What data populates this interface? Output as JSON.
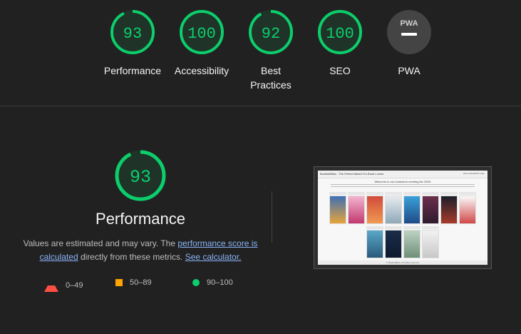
{
  "categories": [
    {
      "label": "Performance",
      "score": "93",
      "fraction": 0.93,
      "color": "#0cce6b"
    },
    {
      "label": "Accessibility",
      "score": "100",
      "fraction": 1.0,
      "color": "#0cce6b"
    },
    {
      "label": "Best\nPractices",
      "score": "92",
      "fraction": 0.92,
      "color": "#0cce6b"
    },
    {
      "label": "SEO",
      "score": "100",
      "fraction": 1.0,
      "color": "#0cce6b"
    },
    {
      "label": "PWA",
      "score": "",
      "badge": "PWA"
    }
  ],
  "performance": {
    "title": "Performance",
    "score": "93",
    "fraction": 0.93,
    "desc_prefix": "Values are estimated and may vary. The ",
    "desc_link1": "performance score is calculated",
    "desc_middle": " directly from these metrics. ",
    "desc_link2": "See calculator."
  },
  "legend": {
    "fail": "0–49",
    "average": "50–89",
    "pass": "90–100"
  },
  "screenshot": {
    "site_title": "BookishBliss - The Perfect Match For Book Lovers",
    "nav": "Home    Bookshelf    Login",
    "heading": "Welcome to our bookstore meeting list 2023!",
    "footer": "© BookishBliss. All rights reserved."
  },
  "colors": {
    "pass": "#0cce6b",
    "average": "#ffa400",
    "fail": "#ff4e42",
    "gauge_fill": "#1f3328",
    "pwa_bg": "#444444",
    "pwa_fg": "#cfcfcf"
  }
}
